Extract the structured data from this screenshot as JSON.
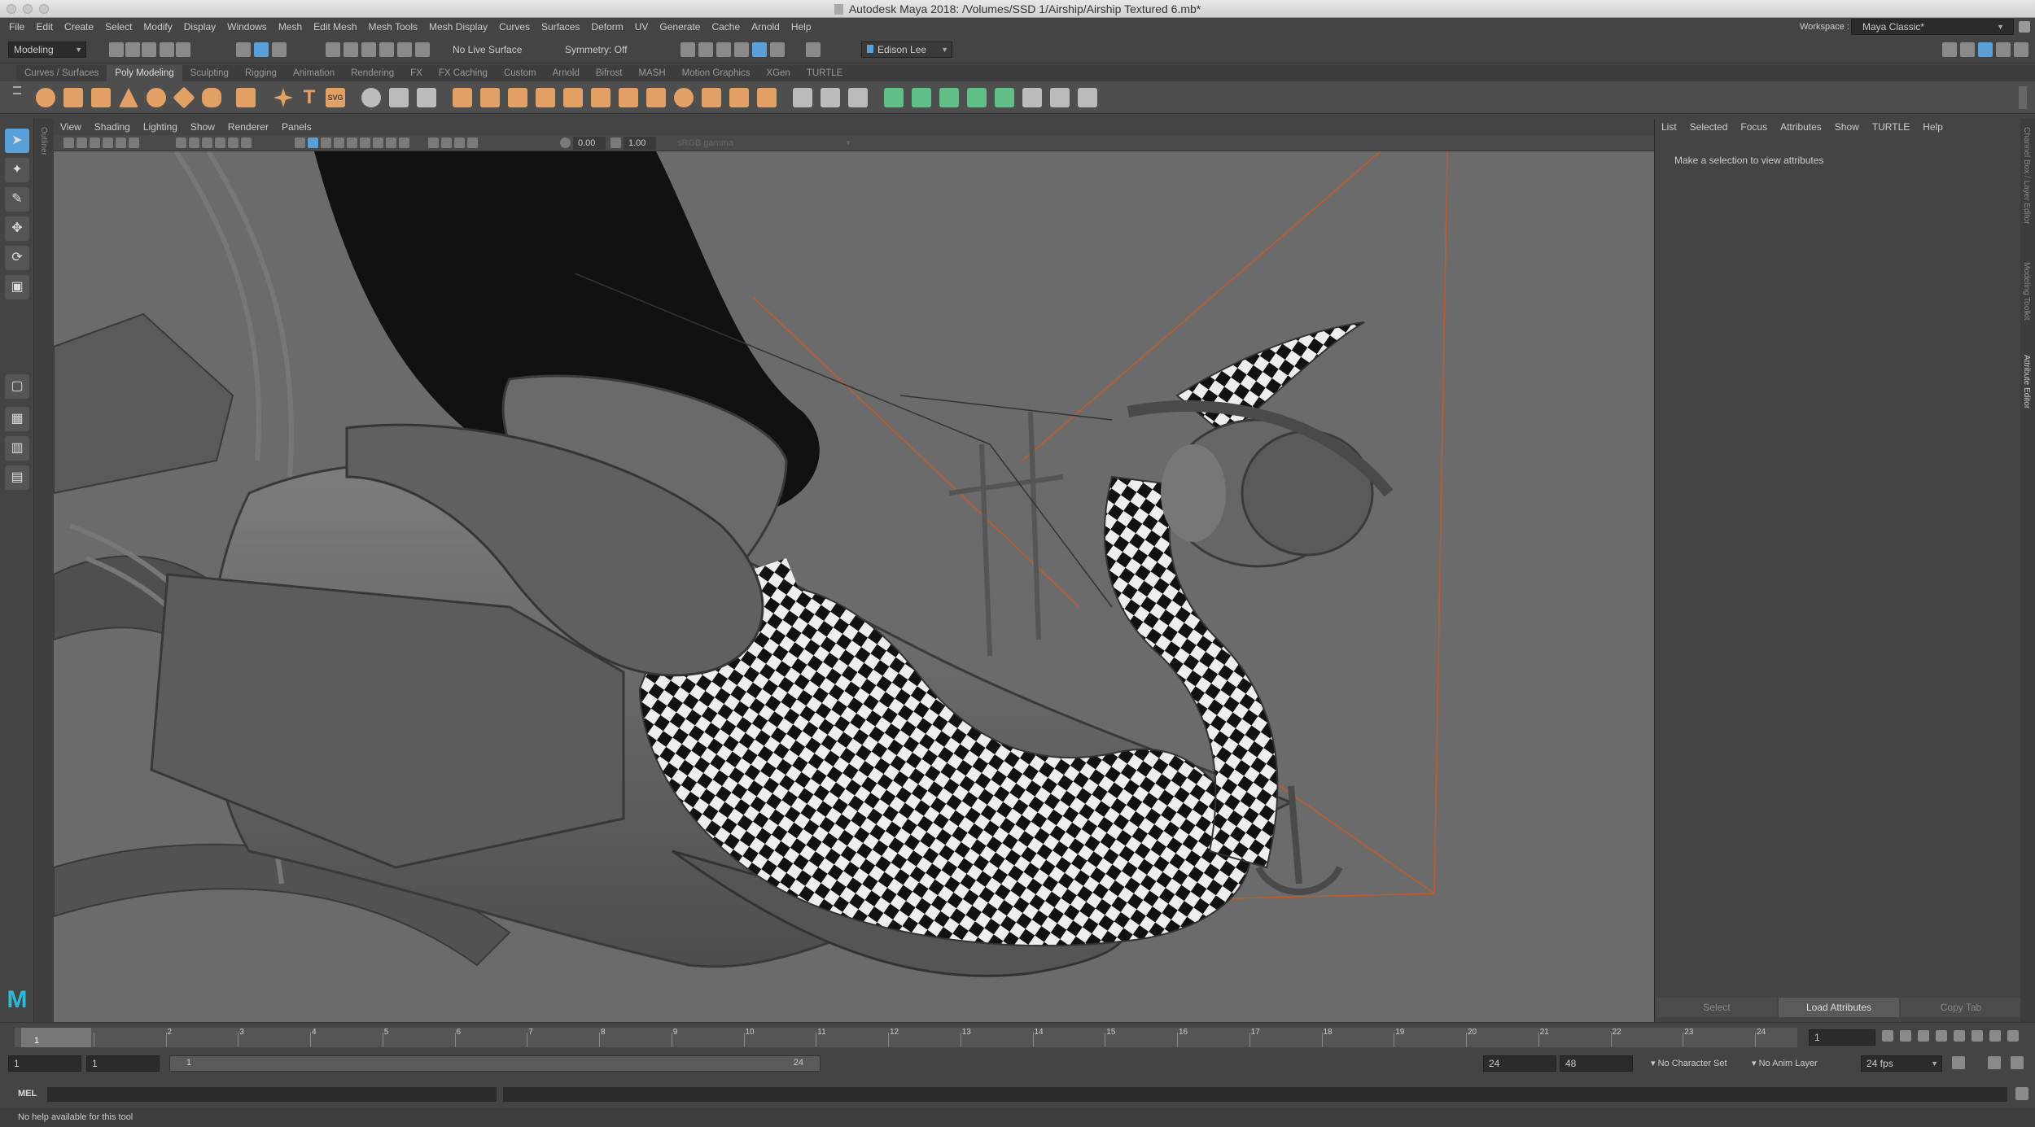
{
  "window": {
    "title": "Autodesk Maya 2018: /Volumes/SSD 1/Airship/Airship Textured 6.mb*",
    "app_icon": "maya-doc-icon"
  },
  "menubar": {
    "items": [
      "File",
      "Edit",
      "Create",
      "Select",
      "Modify",
      "Display",
      "Windows",
      "Mesh",
      "Edit Mesh",
      "Mesh Tools",
      "Mesh Display",
      "Curves",
      "Surfaces",
      "Deform",
      "UV",
      "Generate",
      "Cache",
      "Arnold",
      "Help"
    ],
    "workspace_label": "Workspace :",
    "workspace_value": "Maya Classic*"
  },
  "statusline": {
    "mode": "Modeling",
    "live_surface": "No Live Surface",
    "symmetry": "Symmetry: Off",
    "user": "Edison Lee"
  },
  "shelf": {
    "tabs": [
      "Curves / Surfaces",
      "Poly Modeling",
      "Sculpting",
      "Rigging",
      "Animation",
      "Rendering",
      "FX",
      "FX Caching",
      "Custom",
      "Arnold",
      "Bifrost",
      "MASH",
      "Motion Graphics",
      "XGen",
      "TURTLE"
    ],
    "active_tab": "Poly Modeling",
    "text_tool_label": "T",
    "svg_tool_label": "SVG"
  },
  "toolbox": {
    "outliner_label": "Outliner",
    "logo": "M"
  },
  "viewport": {
    "menu": [
      "View",
      "Shading",
      "Lighting",
      "Show",
      "Renderer",
      "Panels"
    ],
    "exposure": "0.00",
    "gamma": "1.00",
    "color_space": "sRGB gamma"
  },
  "attribute_editor": {
    "menu": [
      "List",
      "Selected",
      "Focus",
      "Attributes",
      "Show",
      "TURTLE",
      "Help"
    ],
    "message": "Make a selection to view attributes",
    "buttons": [
      "Select",
      "Load Attributes",
      "Copy Tab"
    ]
  },
  "side_tabs": [
    "Channel Box / Layer Editor",
    "Modeling Toolkit",
    "Attribute Editor"
  ],
  "timeslider": {
    "ticks": [
      "1",
      "2",
      "3",
      "4",
      "5",
      "6",
      "7",
      "8",
      "9",
      "10",
      "11",
      "12",
      "13",
      "14",
      "15",
      "16",
      "17",
      "18",
      "19",
      "20",
      "21",
      "22",
      "23",
      "24"
    ],
    "current_frame": "1",
    "current_frame_field": "1"
  },
  "range": {
    "start": "1",
    "playback_start": "1",
    "range_start": "1",
    "range_end": "24",
    "playback_end": "24",
    "end": "48",
    "character_set": "No Character Set",
    "anim_layer": "No Anim Layer",
    "fps": "24 fps"
  },
  "cmdline": {
    "lang": "MEL"
  },
  "helpline": {
    "text": "No help available for this tool"
  },
  "colors": {
    "shelf_icon": "#e3a064",
    "poly_green": "#5fbf86",
    "select_blue": "#5aa0d8",
    "camera_frustum": "#c45a2a"
  }
}
